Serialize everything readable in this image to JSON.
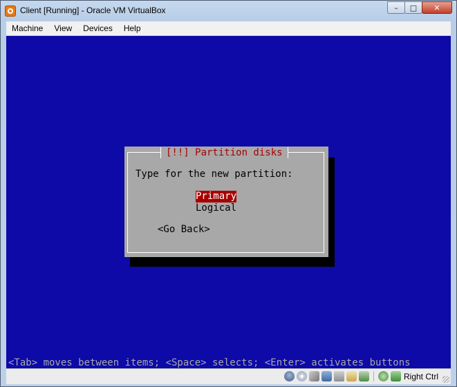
{
  "window": {
    "title": "Client [Running] - Oracle VM VirtualBox",
    "controls": {
      "minimize": "–",
      "maximize": "□",
      "close": "✕"
    }
  },
  "menubar": {
    "items": [
      {
        "label": "Machine"
      },
      {
        "label": "View"
      },
      {
        "label": "Devices"
      },
      {
        "label": "Help"
      }
    ]
  },
  "installer": {
    "dialog_title": "[!!] Partition disks",
    "prompt": "Type for the new partition:",
    "options": [
      {
        "label": "Primary",
        "selected": true
      },
      {
        "label": "Logical",
        "selected": false
      }
    ],
    "back_button": "<Go Back>",
    "hint": "<Tab> moves between items; <Space> selects; <Enter> activates buttons"
  },
  "statusbar": {
    "icons": [
      "hard-disk-icon",
      "optical-drive-icon",
      "floppy-icon",
      "network-icon",
      "usb-icon",
      "shared-folders-icon",
      "remote-display-icon",
      "mouse-integration-icon",
      "keyboard-capture-icon"
    ],
    "host_key": "Right Ctrl"
  },
  "colors": {
    "screen_bg": "#0d0aa8",
    "dialog_bg": "#a8a8a8",
    "dialog_title": "#a80000",
    "selection_bg": "#a80000"
  }
}
